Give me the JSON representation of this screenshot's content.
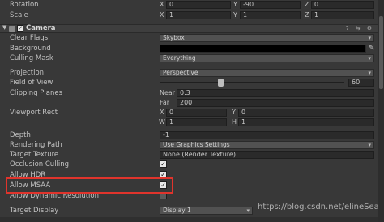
{
  "transform": {
    "rotation": {
      "label": "Rotation",
      "x": "0",
      "y": "-90",
      "z": "0"
    },
    "scale": {
      "label": "Scale",
      "x": "1",
      "y": "1",
      "z": "1"
    }
  },
  "camera": {
    "title": "Camera",
    "fold_icon": "▼",
    "tools": "? ⇆ ⚙",
    "clear_flags": {
      "label": "Clear Flags",
      "value": "Skybox"
    },
    "background": {
      "label": "Background",
      "color": "#000000"
    },
    "culling_mask": {
      "label": "Culling Mask",
      "value": "Everything"
    },
    "projection": {
      "label": "Projection",
      "value": "Perspective"
    },
    "field_of_view": {
      "label": "Field of View",
      "value": "60",
      "slider_fraction": 0.33
    },
    "clipping_planes": {
      "label": "Clipping Planes",
      "near_label": "Near",
      "near": "0.3",
      "far_label": "Far",
      "far": "200"
    },
    "viewport_rect": {
      "label": "Viewport Rect",
      "x_label": "X",
      "x": "0",
      "y_label": "Y",
      "y": "0",
      "w_label": "W",
      "w": "1",
      "h_label": "H",
      "h": "1"
    },
    "depth": {
      "label": "Depth",
      "value": "-1"
    },
    "rendering_path": {
      "label": "Rendering Path",
      "value": "Use Graphics Settings"
    },
    "target_texture": {
      "label": "Target Texture",
      "value": "None (Render Texture)"
    },
    "occlusion_culling": {
      "label": "Occlusion Culling",
      "checked": true
    },
    "allow_hdr": {
      "label": "Allow HDR",
      "checked": true
    },
    "allow_msaa": {
      "label": "Allow MSAA",
      "checked": true
    },
    "allow_dynamic_resolution": {
      "label": "Allow Dynamic Resolution",
      "checked": false
    },
    "target_display": {
      "label": "Target Display",
      "value": "Display 1"
    }
  },
  "axis_labels": {
    "x": "X",
    "y": "Y",
    "z": "Z"
  },
  "glyphs": {
    "check": "✓",
    "dropdown_arrow": "▾",
    "color_picker": "✎"
  },
  "watermark": "https://blog.csdn.net/elineSea",
  "colors": {
    "highlight": "#e0342c",
    "panel": "#383838"
  }
}
